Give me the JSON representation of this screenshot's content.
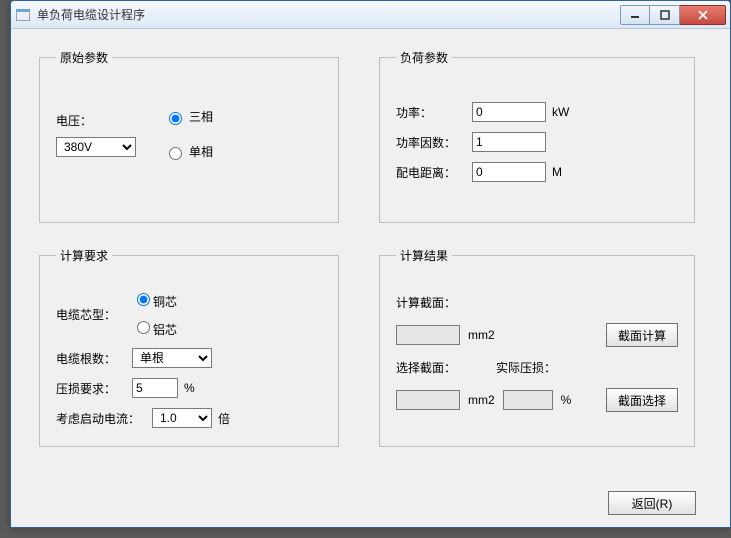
{
  "window": {
    "title": "单负荷电缆设计程序"
  },
  "groups": {
    "original": "原始参数",
    "load": "负荷参数",
    "calcreq": "计算要求",
    "result": "计算结果"
  },
  "original": {
    "voltage_label": "电压：",
    "voltage_value": "380V",
    "three_phase": "三相",
    "single_phase": "单相"
  },
  "load": {
    "power_label": "功率：",
    "power_value": "0",
    "power_unit": "kW",
    "pf_label": "功率因数：",
    "pf_value": "1",
    "distance_label": "配电距离：",
    "distance_value": "0",
    "distance_unit": "M"
  },
  "calcreq": {
    "core_label": "电缆芯型：",
    "copper": "铜芯",
    "aluminum": "铝芯",
    "count_label": "电缆根数：",
    "count_value": "单根",
    "loss_label": "压损要求：",
    "loss_value": "5",
    "loss_unit": "%",
    "start_label": "考虑启动电流：",
    "start_value": "1.0",
    "start_unit": "倍"
  },
  "result": {
    "calc_section_label": "计算截面：",
    "calc_section_value": "",
    "mm2": "mm2",
    "btn_calc": "截面计算",
    "sel_section_label": "选择截面：",
    "actual_loss_label": "实际压损：",
    "sel_section_value": "",
    "actual_loss_value": "",
    "pct": "%",
    "btn_select": "截面选择"
  },
  "buttons": {
    "return": "返回(R)"
  }
}
